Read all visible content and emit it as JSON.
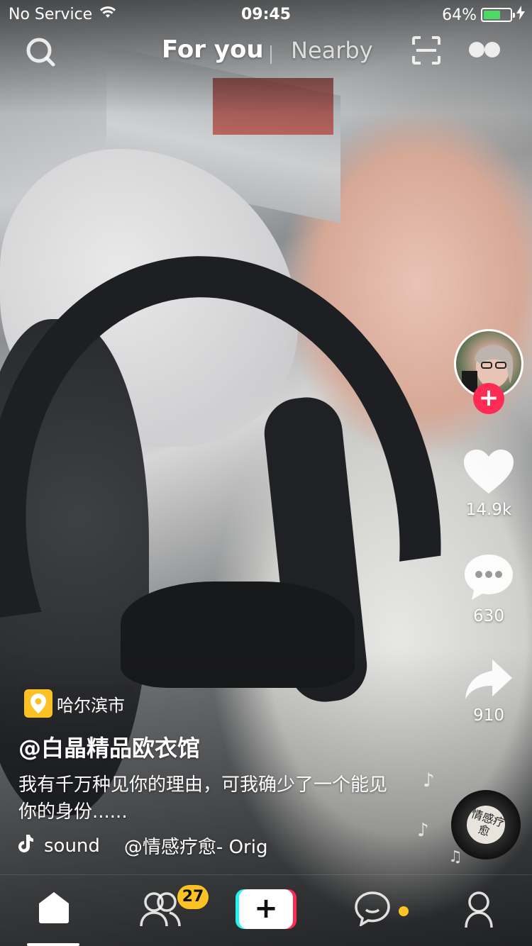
{
  "status_bar": {
    "carrier": "No Service",
    "time": "09:45",
    "battery_percent": "64%",
    "battery_level": 0.64,
    "battery_color": "#4cd964"
  },
  "top_nav": {
    "tab_for_you": "For you",
    "tab_nearby": "Nearby",
    "search_icon": "search-icon",
    "scan_icon": "scan-icon",
    "live_icon": "live-icon"
  },
  "sidebar": {
    "likes": "14.9k",
    "comments": "630",
    "shares": "910",
    "follow_icon": "plus-icon",
    "disc_text": "情感疗愈"
  },
  "caption": {
    "location": "哈尔滨市",
    "username": "@白晶精品欧衣馆",
    "description": "我有千万种见你的理由，可我确少了一个能见你的身份......",
    "sound_label": "sound",
    "sound_track": "@情感疗愈- Orig"
  },
  "bottom_bar": {
    "friends_badge": "27",
    "plus_label": "+",
    "accent_yellow": "#fcc225",
    "accent_red": "#fe2c55",
    "accent_cyan": "#25f4ee"
  }
}
